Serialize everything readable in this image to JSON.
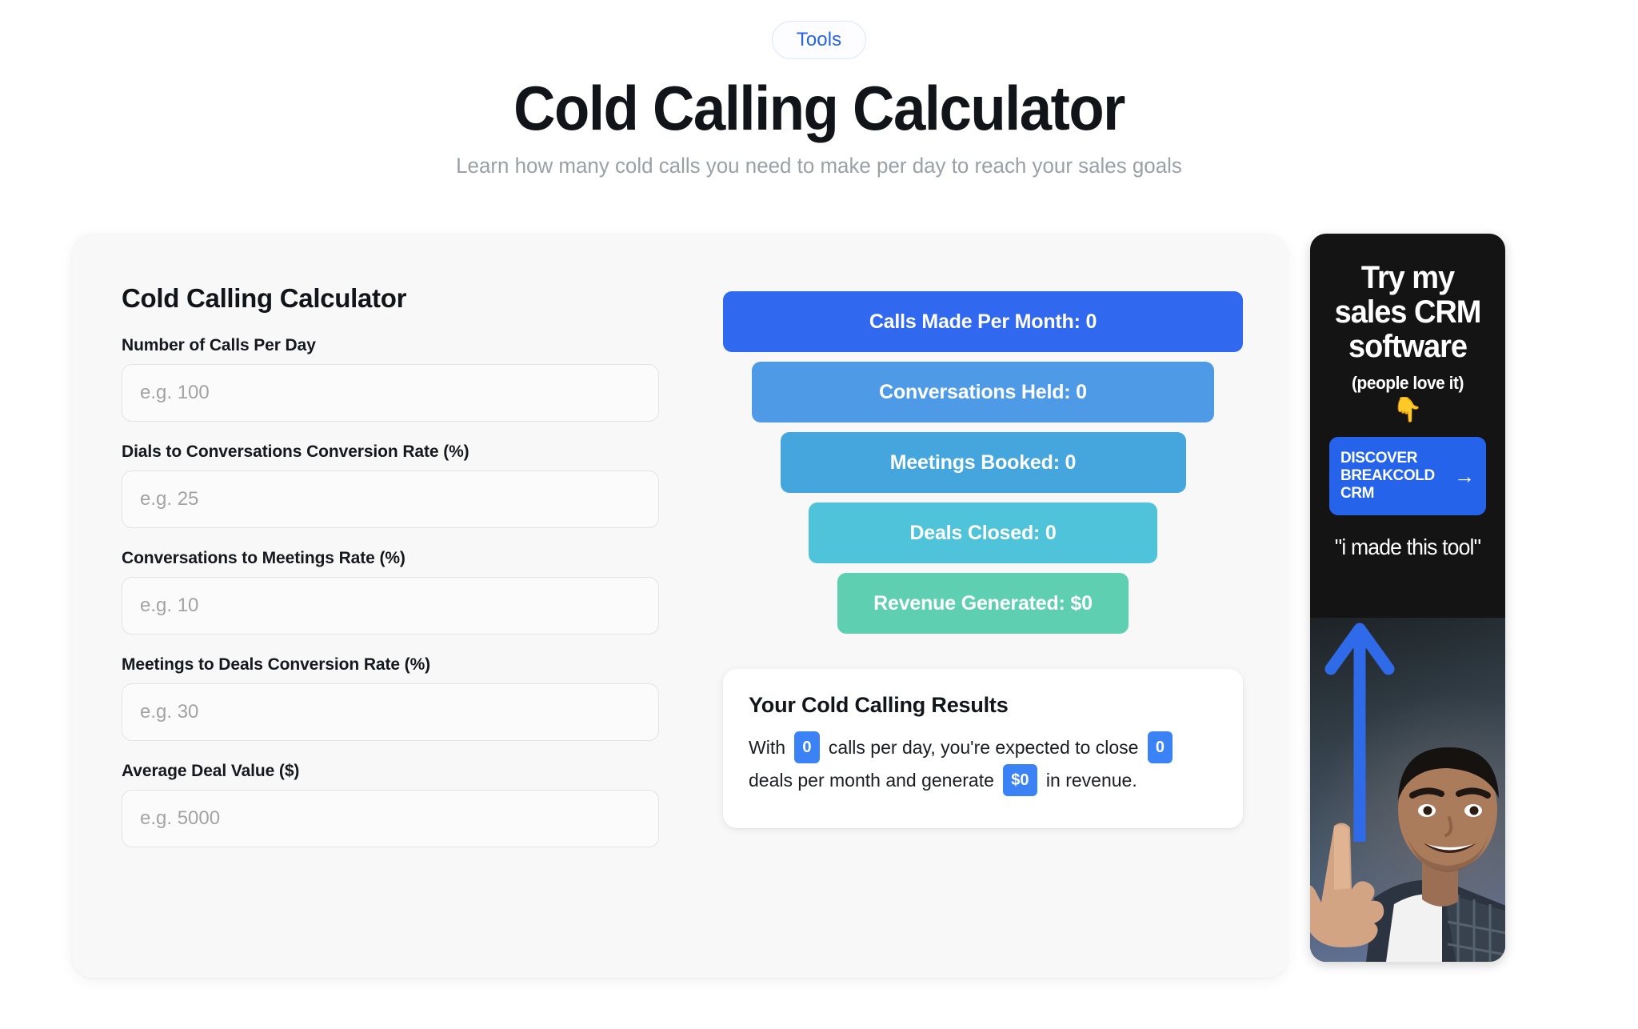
{
  "header": {
    "badge": "Tools",
    "title": "Cold Calling Calculator",
    "subtitle": "Learn how many cold calls you need to make per day to reach your sales goals"
  },
  "calculator": {
    "title": "Cold Calling Calculator",
    "fields": [
      {
        "label": "Number of Calls Per Day",
        "placeholder": "e.g. 100",
        "value": ""
      },
      {
        "label": "Dials to Conversations Conversion Rate (%)",
        "placeholder": "e.g. 25",
        "value": ""
      },
      {
        "label": "Conversations to Meetings Rate (%)",
        "placeholder": "e.g. 10",
        "value": ""
      },
      {
        "label": "Meetings to Deals Conversion Rate (%)",
        "placeholder": "e.g. 30",
        "value": ""
      },
      {
        "label": "Average Deal Value ($)",
        "placeholder": "e.g. 5000",
        "value": ""
      }
    ]
  },
  "funnel": {
    "bars": [
      {
        "label": "Calls Made Per Month: 0",
        "color": "#3069ef",
        "width_pct": 100
      },
      {
        "label": "Conversations Held: 0",
        "color": "#4e9ae6",
        "width_pct": 89
      },
      {
        "label": "Meetings Booked: 0",
        "color": "#45a6dd",
        "width_pct": 78
      },
      {
        "label": "Deals Closed: 0",
        "color": "#4fc3da",
        "width_pct": 67
      },
      {
        "label": "Revenue Generated: $0",
        "color": "#5fcfb1",
        "width_pct": 56
      }
    ]
  },
  "results": {
    "title": "Your Cold Calling Results",
    "prefix": "With",
    "calls_value": "0",
    "middle": "calls per day, you're expected to close",
    "deals_value": "0",
    "middle2": "deals per month and generate",
    "revenue_value": "$0",
    "suffix": "in revenue."
  },
  "ad": {
    "headline": "Try my sales CRM software",
    "subline": "(people love it)",
    "point_emoji": "👇",
    "cta_label": "DISCOVER BREAKCOLD CRM",
    "cta_arrow": "→",
    "quote": "\"i made this tool\""
  },
  "colors": {
    "accent_blue": "#2563eb",
    "chip_blue": "#3b82f6",
    "funnel_green": "#5fcfb1",
    "card_bg": "#f8f8f8"
  },
  "chart_data": {
    "type": "bar",
    "title": "Cold Calling Funnel",
    "categories": [
      "Calls Made Per Month",
      "Conversations Held",
      "Meetings Booked",
      "Deals Closed",
      "Revenue Generated"
    ],
    "values": [
      0,
      0,
      0,
      0,
      0
    ],
    "value_labels": [
      "0",
      "0",
      "0",
      "0",
      "$0"
    ],
    "xlabel": "",
    "ylabel": "",
    "orientation": "horizontal-funnel",
    "legend": "none",
    "grid": false
  }
}
